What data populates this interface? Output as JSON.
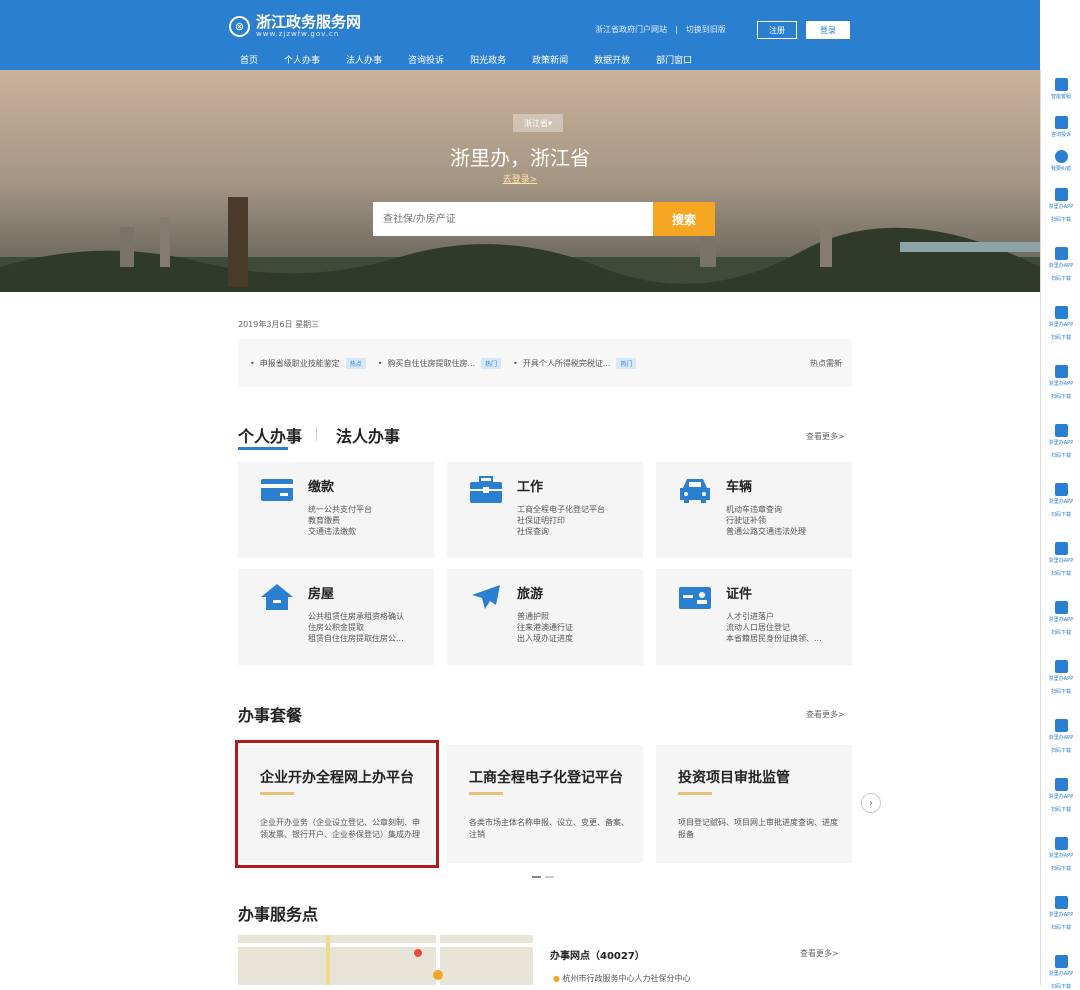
{
  "header": {
    "logo_title": "浙江政务服务网",
    "logo_sub": "www.zjzwfw.gov.cn",
    "portal_link": "浙江省政府门户网站",
    "separator": "|",
    "old_version": "切换到旧版",
    "register": "注册",
    "login": "登录"
  },
  "nav": [
    "首页",
    "个人办事",
    "法人办事",
    "咨询投诉",
    "阳光政务",
    "政策新闻",
    "数据开放",
    "部门窗口"
  ],
  "hero": {
    "province": "浙江省▾",
    "title": "浙里办，浙江省",
    "login_link": "去登录>",
    "search_placeholder": "查社保/办房产证",
    "search_button": "搜索"
  },
  "date": "2019年3月6日 星期三",
  "hot": {
    "items": [
      {
        "text": "申报省级职业技能鉴定",
        "tag": "热点"
      },
      {
        "text": "购买自住住房提取住房...",
        "tag": "热门"
      },
      {
        "text": "开具个人所得税完税证...",
        "tag": "热门"
      }
    ],
    "label": "热点需新"
  },
  "services": {
    "tab_personal": "个人办事",
    "tab_legal": "法人办事",
    "more": "查看更多>",
    "cards": [
      {
        "title": "缴款",
        "icon": "card-payment-icon",
        "lines": [
          "统一公共支付平台",
          "教育缴费",
          "交通违法缴款"
        ]
      },
      {
        "title": "工作",
        "icon": "briefcase-icon",
        "lines": [
          "工商全程电子化登记平台",
          "社保证明打印",
          "社保查询"
        ]
      },
      {
        "title": "车辆",
        "icon": "car-icon",
        "lines": [
          "机动车违章查询",
          "行驶证补领",
          "普通公路交通违法处理"
        ]
      },
      {
        "title": "房屋",
        "icon": "house-icon",
        "lines": [
          "公共租赁住房承租资格确认",
          "住房公积金提取",
          "租赁自住住房提取住房公..."
        ]
      },
      {
        "title": "旅游",
        "icon": "airplane-icon",
        "lines": [
          "普通护照",
          "往来港澳通行证",
          "出入境办证进度"
        ]
      },
      {
        "title": "证件",
        "icon": "id-card-icon",
        "lines": [
          "人才引进落户",
          "流动人口居住登记",
          "本省籍居民身份证换领、..."
        ]
      }
    ]
  },
  "packages": {
    "title": "办事套餐",
    "more": "查看更多>",
    "items": [
      {
        "title": "企业开办全程网上办平台",
        "desc": "企业开办业务（企业设立登记、公章刻制、申领发票、银行开户、企业参保登记）集成办理"
      },
      {
        "title": "工商全程电子化登记平台",
        "desc": "各类市场主体名称申报、设立、变更、备案、注销"
      },
      {
        "title": "投资项目审批监管",
        "desc": "项目登记赋码、项目网上审批进度查询、进度报备"
      }
    ]
  },
  "service_points": {
    "title": "办事服务点",
    "outlets": "办事网点（40027）",
    "more": "查看更多>",
    "first": "杭州市行政服务中心人力社保分中心"
  },
  "rail": {
    "items": [
      "智能客服",
      "咨询投诉",
      "我要纠错"
    ],
    "app_label": "浙里办APP",
    "app_sub": "扫码下载",
    "app_count": 14
  }
}
